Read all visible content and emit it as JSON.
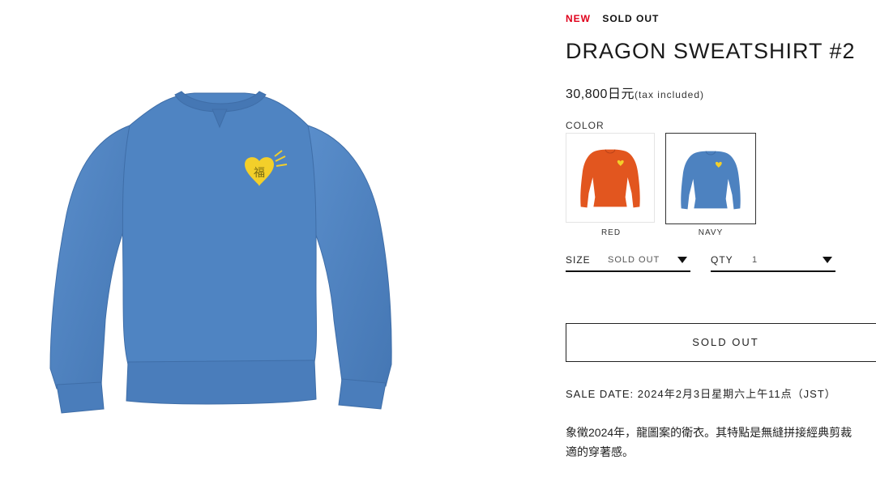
{
  "product": {
    "badge_new": "NEW",
    "badge_soldout": "SOLD OUT",
    "title": "DRAGON SWEATSHIRT #2",
    "price": "30,800日元",
    "price_tax": "(tax included)"
  },
  "color": {
    "label": "COLOR",
    "options": [
      {
        "name": "RED",
        "swatch": "#e2561f",
        "selected": false
      },
      {
        "name": "NAVY",
        "swatch": "#4d82c0",
        "selected": true
      }
    ]
  },
  "size": {
    "label": "SIZE",
    "value": "SOLD OUT"
  },
  "qty": {
    "label": "QTY",
    "value": "1"
  },
  "buy_button": {
    "label": "SOLD OUT"
  },
  "sale_date": "SALE DATE: 2024年2月3日星期六上午11点（JST）",
  "description": {
    "line1": "象徵2024年，龍圖案的衛衣。其特點是無縫拼接經典剪裁",
    "line2": "適的穿著感。"
  },
  "image": {
    "main_color": "#4d82c0",
    "emblem_color": "#f3cf2a",
    "emblem_char": "福",
    "icon": "sweatshirt-image"
  }
}
